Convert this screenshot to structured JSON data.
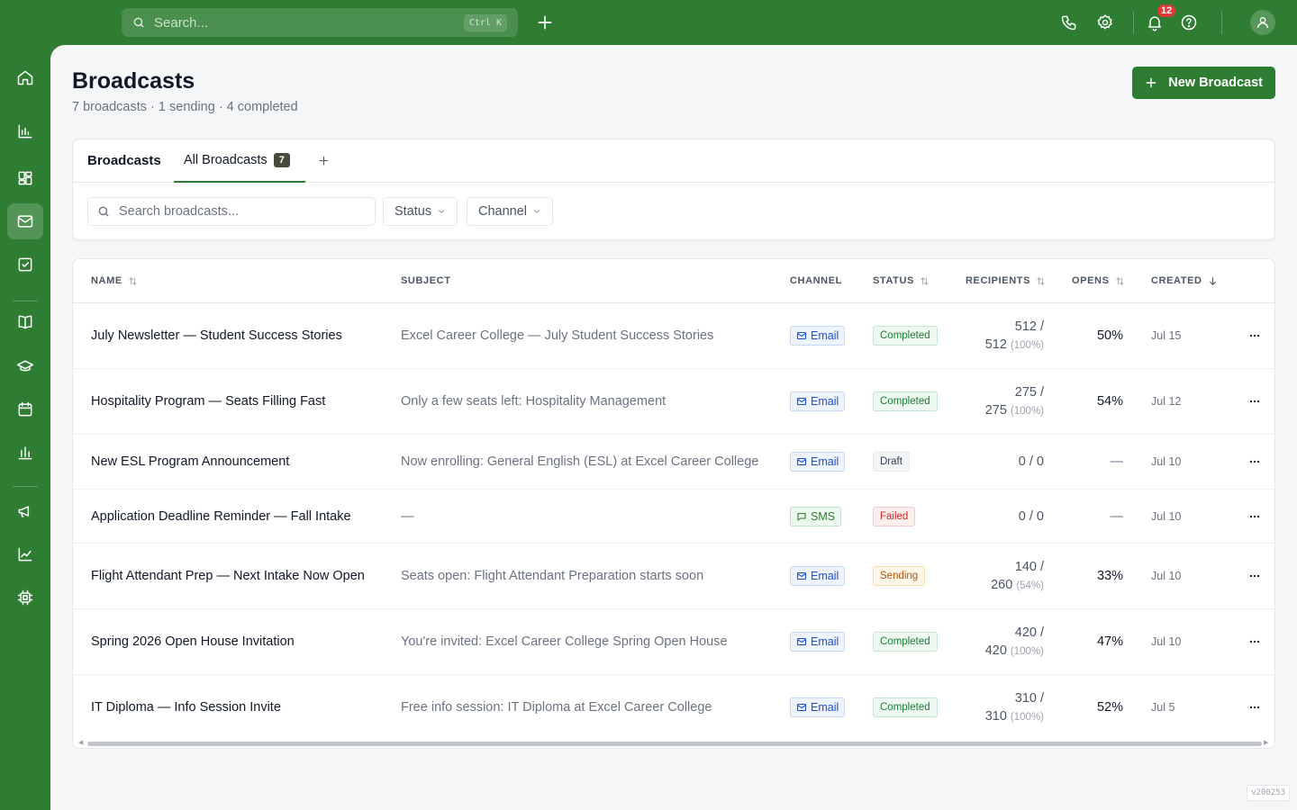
{
  "topbar": {
    "search_placeholder": "Search...",
    "search_shortcut": "Ctrl K",
    "notification_count": "12"
  },
  "page": {
    "title": "Broadcasts",
    "subtitle": "7 broadcasts · 1 sending · 4 completed",
    "new_button": "New Broadcast"
  },
  "filters": {
    "section_title": "Broadcasts",
    "tab_label": "All Broadcasts",
    "tab_count": "7",
    "search_placeholder": "Search broadcasts...",
    "status_label": "Status",
    "channel_label": "Channel"
  },
  "table": {
    "headers": {
      "name": "NAME",
      "subject": "SUBJECT",
      "channel": "CHANNEL",
      "status": "STATUS",
      "recipients": "RECIPIENTS",
      "opens": "OPENS",
      "created": "CREATED"
    },
    "rows": [
      {
        "name": "July Newsletter — Student Success Stories",
        "subject": "Excel Career College — July Student Success Stories",
        "channel": "Email",
        "status": "Completed",
        "recip_line1": "512 /",
        "recip_line2": "512",
        "recip_pct": "(100%)",
        "opens": "50%",
        "created": "Jul 15"
      },
      {
        "name": "Hospitality Program — Seats Filling Fast",
        "subject": "Only a few seats left: Hospitality Management",
        "channel": "Email",
        "status": "Completed",
        "recip_line1": "275 /",
        "recip_line2": "275",
        "recip_pct": "(100%)",
        "opens": "54%",
        "created": "Jul 12"
      },
      {
        "name": "New ESL Program Announcement",
        "subject": "Now enrolling: General English (ESL) at Excel Career College",
        "channel": "Email",
        "status": "Draft",
        "recip_single": "0 / 0",
        "opens": "—",
        "created": "Jul 10"
      },
      {
        "name": "Application Deadline Reminder — Fall Intake",
        "subject": "—",
        "channel": "SMS",
        "status": "Failed",
        "recip_single": "0 / 0",
        "opens": "—",
        "created": "Jul 10"
      },
      {
        "name": "Flight Attendant Prep — Next Intake Now Open",
        "subject": "Seats open: Flight Attendant Preparation starts soon",
        "channel": "Email",
        "status": "Sending",
        "recip_line1": "140 /",
        "recip_line2": "260",
        "recip_pct": "(54%)",
        "opens": "33%",
        "created": "Jul 10"
      },
      {
        "name": "Spring 2026 Open House Invitation",
        "subject": "You're invited: Excel Career College Spring Open House",
        "channel": "Email",
        "status": "Completed",
        "recip_line1": "420 /",
        "recip_line2": "420",
        "recip_pct": "(100%)",
        "opens": "47%",
        "created": "Jul 10"
      },
      {
        "name": "IT Diploma — Info Session Invite",
        "subject": "Free info session: IT Diploma at Excel Career College",
        "channel": "Email",
        "status": "Completed",
        "recip_line1": "310 /",
        "recip_line2": "310",
        "recip_pct": "(100%)",
        "opens": "52%",
        "created": "Jul 5"
      }
    ]
  },
  "version": "v200253",
  "colors": {
    "brand": "#2e7d32",
    "notification": "#e53935",
    "email_chip": "#1d4ed8",
    "completed": "#1f7a36",
    "failed": "#c62828",
    "sending": "#b45309"
  },
  "icons": {
    "sidebar": [
      "home-icon",
      "bar-chart-icon",
      "dashboard-icon",
      "mail-icon",
      "checkbox-icon",
      "book-icon",
      "graduation-cap-icon",
      "calendar-icon",
      "analytics-icon",
      "megaphone-icon",
      "line-chart-icon",
      "chip-icon"
    ],
    "topbar": [
      "search-icon",
      "plus-icon",
      "phone-icon",
      "gear-icon",
      "bell-icon",
      "help-icon",
      "user-icon"
    ]
  }
}
